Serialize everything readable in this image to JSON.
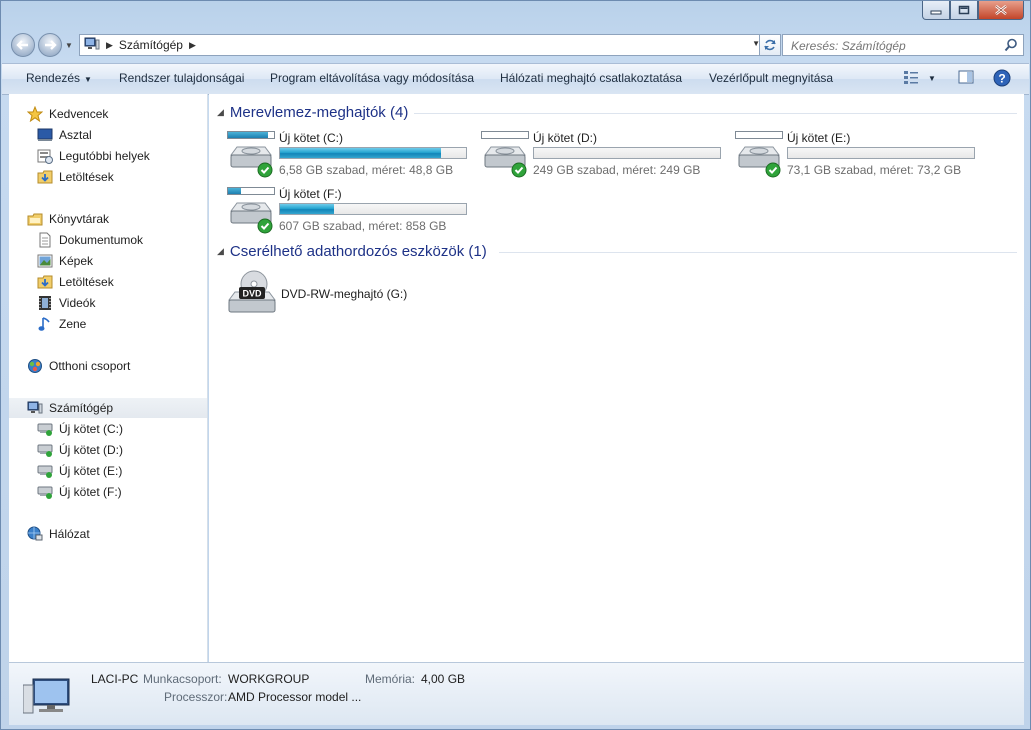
{
  "window": {
    "controls": [
      "minimize",
      "maximize",
      "close"
    ]
  },
  "address": {
    "location": "Számítógép",
    "search_placeholder": "Keresés: Számítógép"
  },
  "toolbar": {
    "organize": "Rendezés",
    "system_properties": "Rendszer tulajdonságai",
    "uninstall": "Program eltávolítása vagy módosítása",
    "map_drive": "Hálózati meghajtó csatlakoztatása",
    "control_panel": "Vezérlőpult megnyitása"
  },
  "nav": {
    "favorites": "Kedvencek",
    "desktop": "Asztal",
    "recent": "Legutóbbi helyek",
    "downloads": "Letöltések",
    "libraries": "Könyvtárak",
    "documents": "Dokumentumok",
    "pictures": "Képek",
    "lib_downloads": "Letöltések",
    "videos": "Videók",
    "music": "Zene",
    "homegroup": "Otthoni csoport",
    "computer": "Számítógép",
    "drive_c": "Új kötet (C:)",
    "drive_d": "Új kötet (D:)",
    "drive_e": "Új kötet (E:)",
    "drive_f": "Új kötet (F:)",
    "network": "Hálózat"
  },
  "groups": {
    "hdd": "Merevlemez-meghajtók (4)",
    "removable": "Cserélhető adathordozós eszközök (1)"
  },
  "drives": [
    {
      "name": "Új kötet (C:)",
      "info": "6,58 GB szabad, méret: 48,8 GB",
      "used_fraction": 0.865
    },
    {
      "name": "Új kötet (D:)",
      "info": "249 GB szabad, méret: 249 GB",
      "used_fraction": 0.0
    },
    {
      "name": "Új kötet (E:)",
      "info": "73,1 GB szabad, méret: 73,2 GB",
      "used_fraction": 0.002
    },
    {
      "name": "Új kötet (F:)",
      "info": "607 GB szabad, méret: 858 GB",
      "used_fraction": 0.29
    }
  ],
  "dvd": {
    "name": "DVD-RW-meghajtó (G:)",
    "badge": "DVD"
  },
  "details": {
    "pc_name": "LACI-PC",
    "workgroup_label": "Munkacsoport:",
    "workgroup_value": "WORKGROUP",
    "memory_label": "Memória:",
    "memory_value": "4,00 GB",
    "processor_label": "Processzor:",
    "processor_value": "AMD Processor model ..."
  },
  "colors": {
    "accent_bar": "#26a6d1",
    "group_header": "#1e3287",
    "check_green": "#2fa33a"
  }
}
